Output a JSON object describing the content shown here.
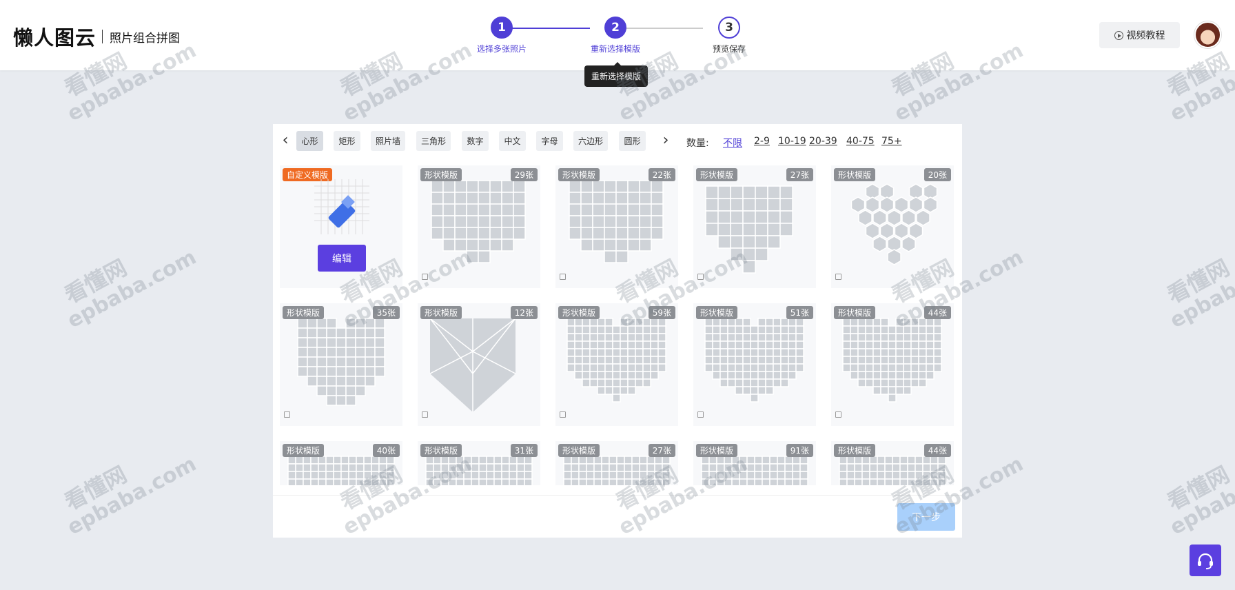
{
  "header": {
    "logo_main": "懒人图云",
    "logo_sub": "照片组合拼图",
    "video_button": "视频教程",
    "steps": [
      {
        "num": "1",
        "label": "选择多张照片",
        "state": "done"
      },
      {
        "num": "2",
        "label": "重新选择模版",
        "state": "done"
      },
      {
        "num": "3",
        "label": "预览保存",
        "state": "todo"
      }
    ],
    "tooltip": "重新选择模版"
  },
  "filters": {
    "categories": [
      "心形",
      "矩形",
      "照片墙",
      "三角形",
      "数字",
      "中文",
      "字母",
      "六边形",
      "圆形"
    ],
    "active_category": "心形",
    "quantity_label": "数量:",
    "quantity_options": [
      "不限",
      "2-9",
      "10-19",
      "20-39",
      "40-75",
      "75+"
    ],
    "active_quantity": "不限"
  },
  "custom_card": {
    "badge": "自定义模版",
    "edit_label": "编辑"
  },
  "templates": [
    {
      "badge": "形状模版",
      "count": "29张",
      "pattern": "heart-mixed"
    },
    {
      "badge": "形状模版",
      "count": "22张",
      "pattern": "heart-mixed2"
    },
    {
      "badge": "形状模版",
      "count": "27张",
      "pattern": "heart-rounded"
    },
    {
      "badge": "形状模版",
      "count": "20张",
      "pattern": "heart-hex"
    },
    {
      "badge": "形状模版",
      "count": "35张",
      "pattern": "heart-brick"
    },
    {
      "badge": "形状模版",
      "count": "12张",
      "pattern": "heart-triangle"
    },
    {
      "badge": "形状模版",
      "count": "59张",
      "pattern": "heart-grid"
    },
    {
      "badge": "形状模版",
      "count": "51张",
      "pattern": "heart-grid-center"
    },
    {
      "badge": "形状模版",
      "count": "44张",
      "pattern": "heart-grid-center2"
    },
    {
      "badge": "形状模版",
      "count": "40张",
      "pattern": "heart-partial"
    },
    {
      "badge": "形状模版",
      "count": "31张",
      "pattern": "heart-partial"
    },
    {
      "badge": "形状模版",
      "count": "27张",
      "pattern": "heart-partial"
    },
    {
      "badge": "形状模版",
      "count": "91张",
      "pattern": "heart-partial"
    },
    {
      "badge": "形状模版",
      "count": "44张",
      "pattern": "heart-partial"
    }
  ],
  "footer": {
    "next_button": "下一步"
  },
  "watermark": {
    "line1": "看懂网",
    "line2": "epbaba.com"
  },
  "colors": {
    "accent": "#4f3fd6",
    "badge_orange": "#ef6a22",
    "next_disabled": "#a9d0fb"
  }
}
